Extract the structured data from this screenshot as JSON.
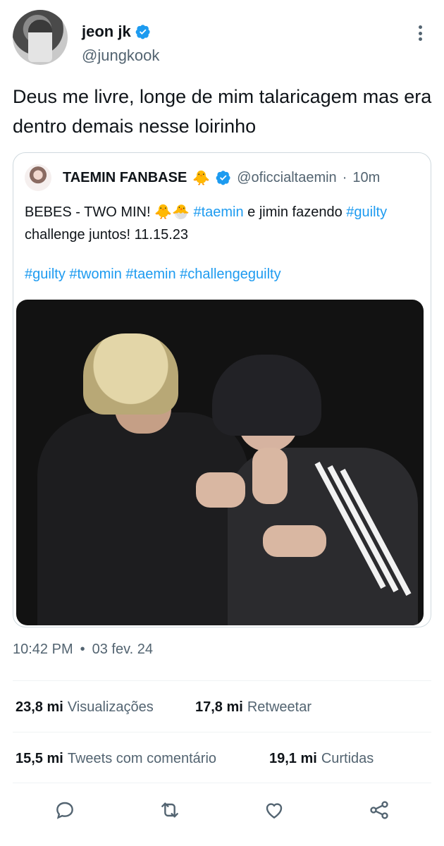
{
  "author": {
    "display_name": "jeon jk",
    "handle": "@jungkook",
    "verified": true,
    "avatar_icon": "profile-photo"
  },
  "tweet": {
    "text": "Deus me livre, longe de mim talaricagem mas era dentro demais nesse loirinho"
  },
  "quote": {
    "display_name": "TAEMIN FANBASE",
    "name_emoji": "🐥",
    "handle": "@oficcialtaemin",
    "separator": "·",
    "time": "10m",
    "body_text_1": "BEBES - TWO MIN! 🐥🐣 ",
    "body_tag_1": "#taemin",
    "body_text_2": " e jimin fazendo ",
    "body_tag_2": "#guilty",
    "body_text_3": " challenge juntos!  11.15.23",
    "tags": [
      "#guilty",
      "#twomin",
      "#taemin",
      "#challengeguilty"
    ]
  },
  "meta": {
    "time": "10:42 PM",
    "dot": "•",
    "date": "03 fev. 24"
  },
  "stats": {
    "views_num": "23,8 mi",
    "views_label": "Visualizações",
    "retweets_num": "17,8 mi",
    "retweets_label": "Retweetar",
    "quotes_num": "15,5 mi",
    "quotes_label": "Tweets com comentário",
    "likes_num": "19,1 mi",
    "likes_label": "Curtidas"
  },
  "colors": {
    "link": "#1d9bf0",
    "secondary_text": "#536471",
    "verified_badge": "#1d9bf0"
  },
  "icons": [
    "verified-badge-icon",
    "more-options-icon",
    "reply-icon",
    "retweet-icon",
    "like-icon",
    "share-icon"
  ]
}
